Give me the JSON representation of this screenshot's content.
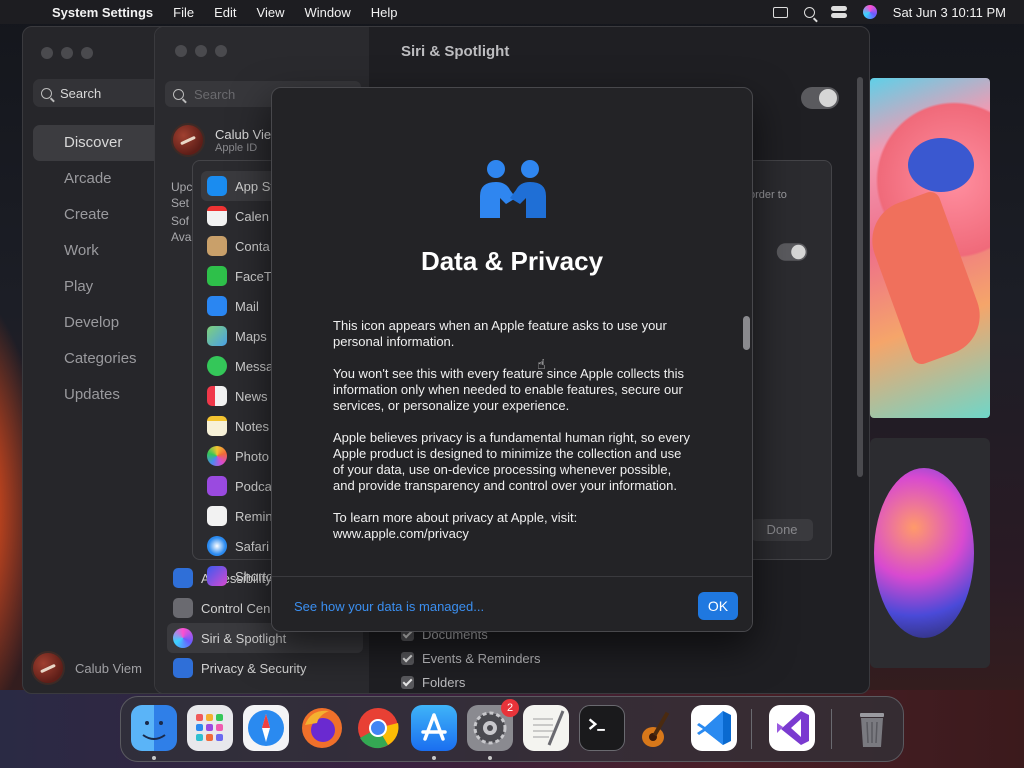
{
  "menubar": {
    "apple_symbol": "",
    "app_name": "System Settings",
    "menus": [
      "File",
      "Edit",
      "View",
      "Window",
      "Help"
    ],
    "clock": "Sat Jun 3  10:11 PM"
  },
  "appstore": {
    "search_label": "Search",
    "nav": [
      "Discover",
      "Arcade",
      "Create",
      "Work",
      "Play",
      "Develop",
      "Categories",
      "Updates"
    ],
    "user_name": "Calub Viem"
  },
  "settings": {
    "search_placeholder": "Search",
    "user_name": "Calub Vie",
    "user_sub": "Apple ID",
    "partial_labels": [
      "Upc",
      "Set",
      "Sof",
      "Ava"
    ],
    "content_title": "Siri & Spotlight",
    "content_snippet": "order to",
    "sidebar_bottom": [
      "Accessibility",
      "Control Cen",
      "Siri & Spotlight",
      "Privacy & Security"
    ],
    "checks": [
      "Documents",
      "Events & Reminders",
      "Folders"
    ]
  },
  "apps_sheet": {
    "apps": [
      "App St",
      "Calen",
      "Conta",
      "FaceTi",
      "Mail",
      "Maps",
      "Messa",
      "News",
      "Notes",
      "Photo",
      "Podca",
      "Remin",
      "Safari",
      "Shorto"
    ],
    "done_label": "Done"
  },
  "dialog": {
    "title": "Data & Privacy",
    "paragraphs": [
      "This icon appears when an Apple feature asks to use your personal information.",
      "You won't see this with every feature since Apple collects this information only when needed to enable features, secure our services, or personalize your experience.",
      "Apple believes privacy is a fundamental human right, so every Apple product is designed to minimize the collection and use of your data, use on-device processing whenever possible, and provide transparency and control over your information.",
      "To learn more about privacy at Apple, visit: www.apple.com/privacy"
    ],
    "link_text": "See how your data is managed...",
    "ok_label": "OK"
  },
  "dock": {
    "apps": [
      "Finder",
      "Launchpad",
      "Safari",
      "Firefox",
      "Chrome",
      "App Store",
      "System Settings",
      "TextEdit",
      "Terminal",
      "GarageBand",
      "Visual Studio Code",
      "Visual Studio",
      "Trash"
    ],
    "settings_badge": "2"
  },
  "colors": {
    "accent": "#1f78e0",
    "link": "#3b8ff0",
    "dialog_bg": "#232326"
  }
}
